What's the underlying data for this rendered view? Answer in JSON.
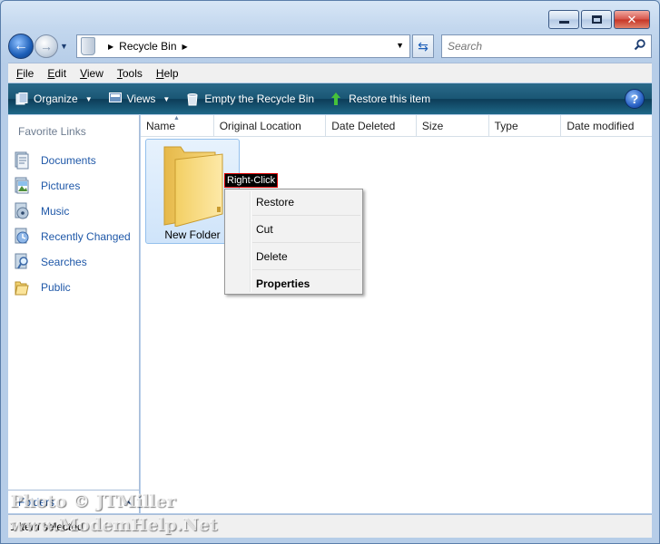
{
  "window": {
    "caption": {
      "minimize": "minimize",
      "maximize": "maximize",
      "close": "close"
    }
  },
  "nav": {
    "address_path": [
      "Recycle Bin"
    ],
    "search_placeholder": "Search"
  },
  "menubar": {
    "items": [
      {
        "label": "File",
        "accel": "F",
        "rest": "ile"
      },
      {
        "label": "Edit",
        "accel": "E",
        "rest": "dit"
      },
      {
        "label": "View",
        "accel": "V",
        "rest": "iew"
      },
      {
        "label": "Tools",
        "accel": "T",
        "rest": "ools"
      },
      {
        "label": "Help",
        "accel": "H",
        "rest": "elp"
      }
    ]
  },
  "commandbar": {
    "organize": "Organize",
    "views": "Views",
    "empty": "Empty the Recycle Bin",
    "restore": "Restore this item"
  },
  "leftpane": {
    "title": "Favorite Links",
    "links": [
      "Documents",
      "Pictures",
      "Music",
      "Recently Changed",
      "Searches",
      "Public"
    ],
    "folders_label": "Folders"
  },
  "columns": [
    "Name",
    "Original Location",
    "Date Deleted",
    "Size",
    "Type",
    "Date modified"
  ],
  "files": [
    {
      "name": "New Folder"
    }
  ],
  "annotation": "Right-Click",
  "context_menu": {
    "items": [
      "Restore",
      "Cut",
      "Delete",
      "Properties"
    ]
  },
  "status": "1 item selected",
  "watermark": {
    "line1": "Photo © JTMiller",
    "line2": "www.ModemHelp.Net"
  },
  "colors": {
    "command_bar": "#1a5674",
    "link_blue": "#1f58a8",
    "selection": "#cfe4fa"
  }
}
